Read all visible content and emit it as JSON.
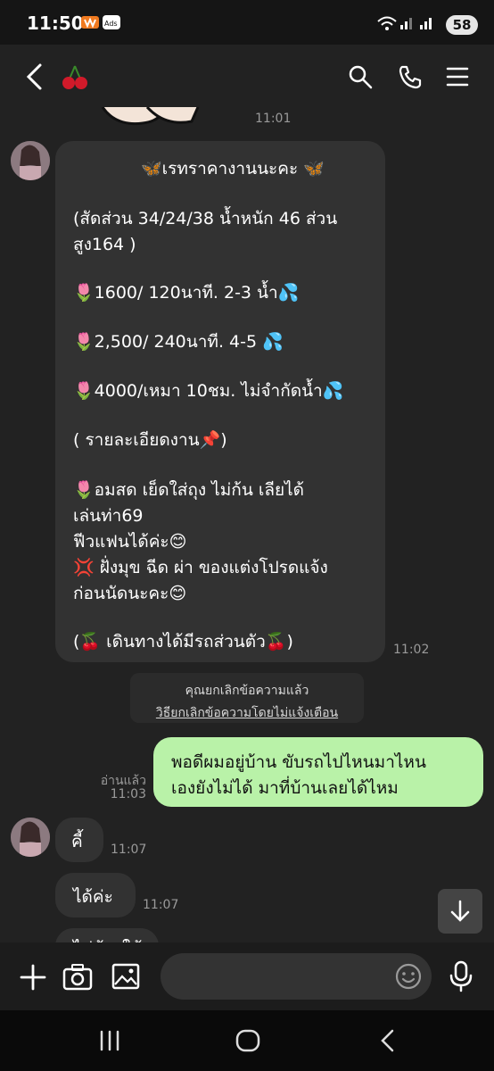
{
  "status": {
    "time": "11:50",
    "battery": "58"
  },
  "header": {
    "title_icon": "cherries-emoji"
  },
  "messages": {
    "m0": {
      "time": "11:01"
    },
    "m1": {
      "time": "11:02",
      "lines": [
        "🦋เรทราคางานนะคะ 🦋",
        "(สัดส่วน 34/24/38 น้ำหนัก 46 ส่วน",
        "สูง164 )",
        "🌷1600/ 120นาที. 2-3 น้ำ💦",
        "🌷2,500/ 240นาที. 4-5 💦",
        "🌷4000/เหมา 10ชม. ไม่จำกัดน้ำ💦",
        "( รายละเอียดงาน📌)",
        "🌷อมสด เย็ดใส่ถุง ไม่ก้น เลียได้",
        "เล่นท่า69",
        "ฟีวแฟนได้ค่ะ😊",
        "💢 ฝั่งมุข ฉีด ผ่า ของแต่งโปรดแจ้ง",
        "ก่อนนัดนะคะ😊",
        "(🍒 เดินทางได้มีรถส่วนตัว🍒)"
      ]
    },
    "system": {
      "line1": "คุณยกเลิกข้อความแล้ว",
      "line2": "วิธียกเลิกข้อความโดยไม่แจ้งเตือน"
    },
    "sent": {
      "read": "อ่านแล้ว",
      "time": "11:03",
      "line1": "พอดีผมอยู่บ้าน ขับรถไปไหนมาไหน",
      "line2": "เองยังไม่ได้ มาที่บ้านเลยได้ไหม"
    },
    "m2": {
      "text": "คี้",
      "time": "11:07"
    },
    "m3": {
      "text": "ได้ค่ะ",
      "time": "11:07"
    },
    "m4": {
      "text": "ไม่ต้องใช้"
    }
  },
  "icons": [
    "back-icon",
    "search-icon",
    "phone-icon",
    "menu-icon",
    "plus-icon",
    "camera-icon",
    "image-icon",
    "emoji-icon",
    "mic-icon",
    "chevron-down-icon"
  ]
}
